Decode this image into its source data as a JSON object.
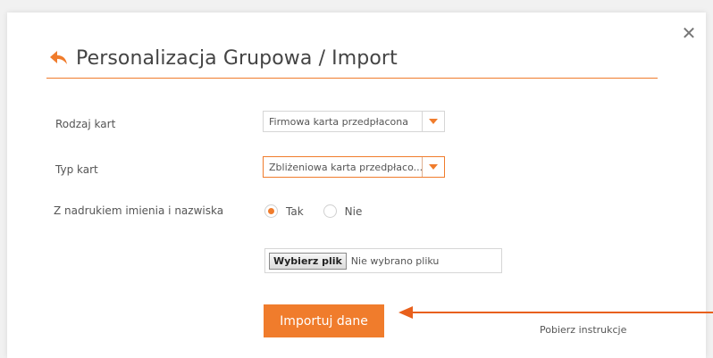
{
  "modal": {
    "title": "Personalizacja Grupowa / Import",
    "close_label": "✕"
  },
  "form": {
    "card_kind": {
      "label": "Rodzaj kart",
      "value": "Firmowa karta przedpłacona"
    },
    "card_type": {
      "label": "Typ kart",
      "value": "Zbliżeniowa karta przedpłaco..."
    },
    "name_print": {
      "label": "Z nadrukiem imienia i nazwiska",
      "options": [
        "Tak",
        "Nie"
      ],
      "selected": "Tak"
    },
    "file": {
      "button_label": "Wybierz plik",
      "status": "Nie wybrano pliku"
    }
  },
  "actions": {
    "import_label": "Importuj dane",
    "instructions_link": "Pobierz instrukcje"
  },
  "colors": {
    "accent": "#f07c2c",
    "background": "#f1f1f1",
    "text": "#555555"
  },
  "icons": {
    "back": "back-arrow-icon",
    "close": "close-icon",
    "caret": "chevron-down-icon",
    "pointer": "arrow-left-icon"
  }
}
